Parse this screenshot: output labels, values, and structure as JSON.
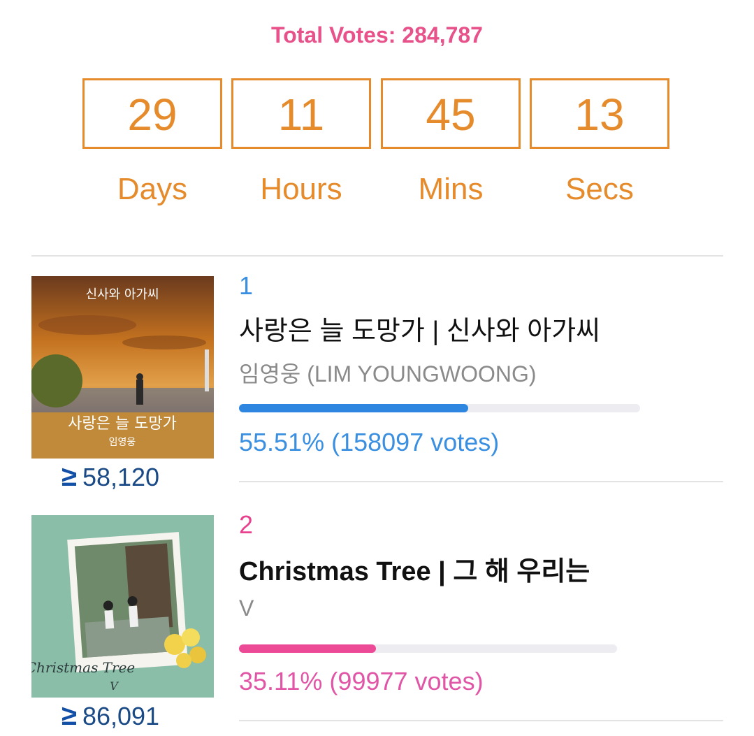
{
  "header": {
    "total_label": "Total Votes:",
    "total_value": "284,787"
  },
  "countdown": [
    {
      "value": "29",
      "unit": "Days"
    },
    {
      "value": "11",
      "unit": "Hours"
    },
    {
      "value": "45",
      "unit": "Mins"
    },
    {
      "value": "13",
      "unit": "Secs"
    }
  ],
  "colors": {
    "pink": "#e8528a",
    "orange": "#e58b2c",
    "blue": "#3a8fe0",
    "magenta": "#e8428f"
  },
  "entries": [
    {
      "rank": "1",
      "title": "사랑은 늘 도망가 | 신사와 아가씨",
      "artist": "임영웅 (LIM YOUNGWOONG)",
      "percent_text": "55.51% (158097 votes)",
      "percent": 55.51,
      "stream_icon": "streaming-arrow-icon",
      "stream_count": "58,120",
      "cover_text": "사랑은 늘 도망가",
      "cover_artist": "임영웅"
    },
    {
      "rank": "2",
      "title": "Christmas Tree | 그 해 우리는",
      "artist": "V",
      "percent_text": "35.11% (99977 votes)",
      "percent": 35.11,
      "stream_icon": "streaming-arrow-icon",
      "stream_count": "86,091",
      "cover_text": "Christmas Tree",
      "cover_artist": "V"
    }
  ]
}
